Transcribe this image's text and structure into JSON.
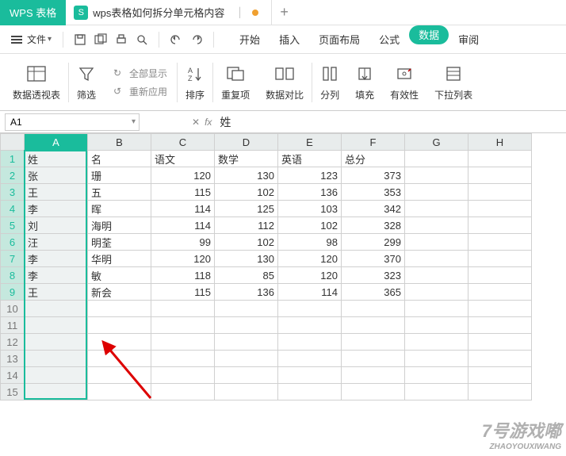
{
  "app": {
    "name": "WPS 表格"
  },
  "document": {
    "title": "wps表格如何拆分单元格内容",
    "type_badge": "S"
  },
  "menu": {
    "file_label": "文件",
    "tabs": [
      "开始",
      "插入",
      "页面布局",
      "公式",
      "数据",
      "审阅"
    ],
    "active_tab_index": 4
  },
  "ribbon": {
    "pivot": "数据透视表",
    "filter": "筛选",
    "show_all": "全部显示",
    "reapply": "重新应用",
    "sort": "排序",
    "dedupe": "重复项",
    "compare": "数据对比",
    "split": "分列",
    "fill": "填充",
    "validation": "有效性",
    "dropdown": "下拉列表"
  },
  "formula_bar": {
    "name_box": "A1",
    "fx_label": "fx",
    "value": "姓"
  },
  "columns": [
    "A",
    "B",
    "C",
    "D",
    "E",
    "F",
    "G",
    "H"
  ],
  "selected_column": "A",
  "row_count": 15,
  "selected_row_range": [
    1,
    9
  ],
  "headers": {
    "A": "姓",
    "B": "名",
    "C": "语文",
    "D": "数学",
    "E": "英语",
    "F": "总分"
  },
  "rows": [
    {
      "A": "张",
      "B": "珊",
      "C": 120,
      "D": 130,
      "E": 123,
      "F": 373
    },
    {
      "A": "王",
      "B": "五",
      "C": 115,
      "D": 102,
      "E": 136,
      "F": 353
    },
    {
      "A": "李",
      "B": "晖",
      "C": 114,
      "D": 125,
      "E": 103,
      "F": 342
    },
    {
      "A": "刘",
      "B": "海明",
      "C": 114,
      "D": 112,
      "E": 102,
      "F": 328
    },
    {
      "A": "汪",
      "B": "明荃",
      "C": 99,
      "D": 102,
      "E": 98,
      "F": 299
    },
    {
      "A": "李",
      "B": "华明",
      "C": 120,
      "D": 130,
      "E": 120,
      "F": 370
    },
    {
      "A": "李",
      "B": "敏",
      "C": 118,
      "D": 85,
      "E": 120,
      "F": 323
    },
    {
      "A": "王",
      "B": "新会",
      "C": 115,
      "D": 136,
      "E": 114,
      "F": 365
    }
  ],
  "watermark": {
    "main": "7号游戏嘟",
    "sub": "ZHAOYOUXIWANG"
  }
}
